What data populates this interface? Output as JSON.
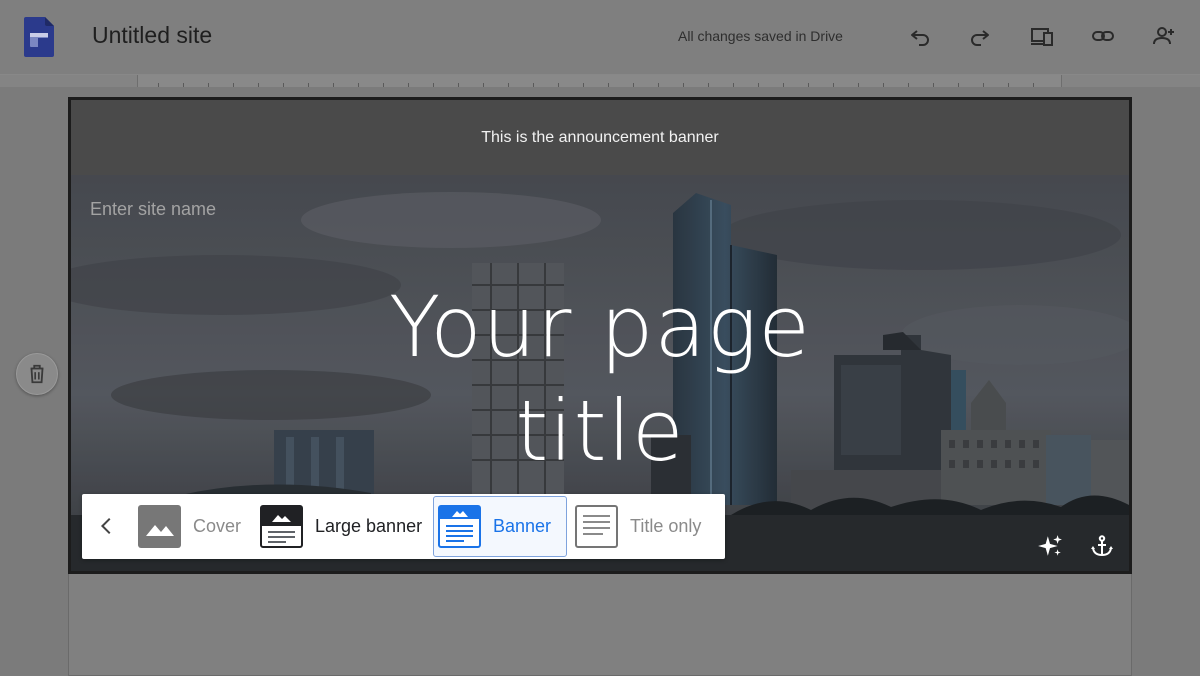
{
  "app": {
    "site_title": "Untitled site",
    "save_status": "All changes saved in Drive"
  },
  "toolbar": {
    "icons": [
      "undo-icon",
      "redo-icon",
      "preview-devices-icon",
      "link-icon",
      "share-add-person-icon"
    ]
  },
  "header": {
    "announcement": "This is the announcement banner",
    "site_name_placeholder": "Enter site name",
    "page_title_line1": "Your page",
    "page_title_line2": "title"
  },
  "layout_chooser": {
    "options": [
      {
        "label": "Cover",
        "selected": false
      },
      {
        "label": "Large banner",
        "selected": false
      },
      {
        "label": "Banner",
        "selected": true
      },
      {
        "label": "Title only",
        "selected": false
      }
    ]
  },
  "colors": {
    "accent": "#1a73e8",
    "announcement_bg": "#4a4a4a",
    "sites_logo": "#3f51b5"
  }
}
